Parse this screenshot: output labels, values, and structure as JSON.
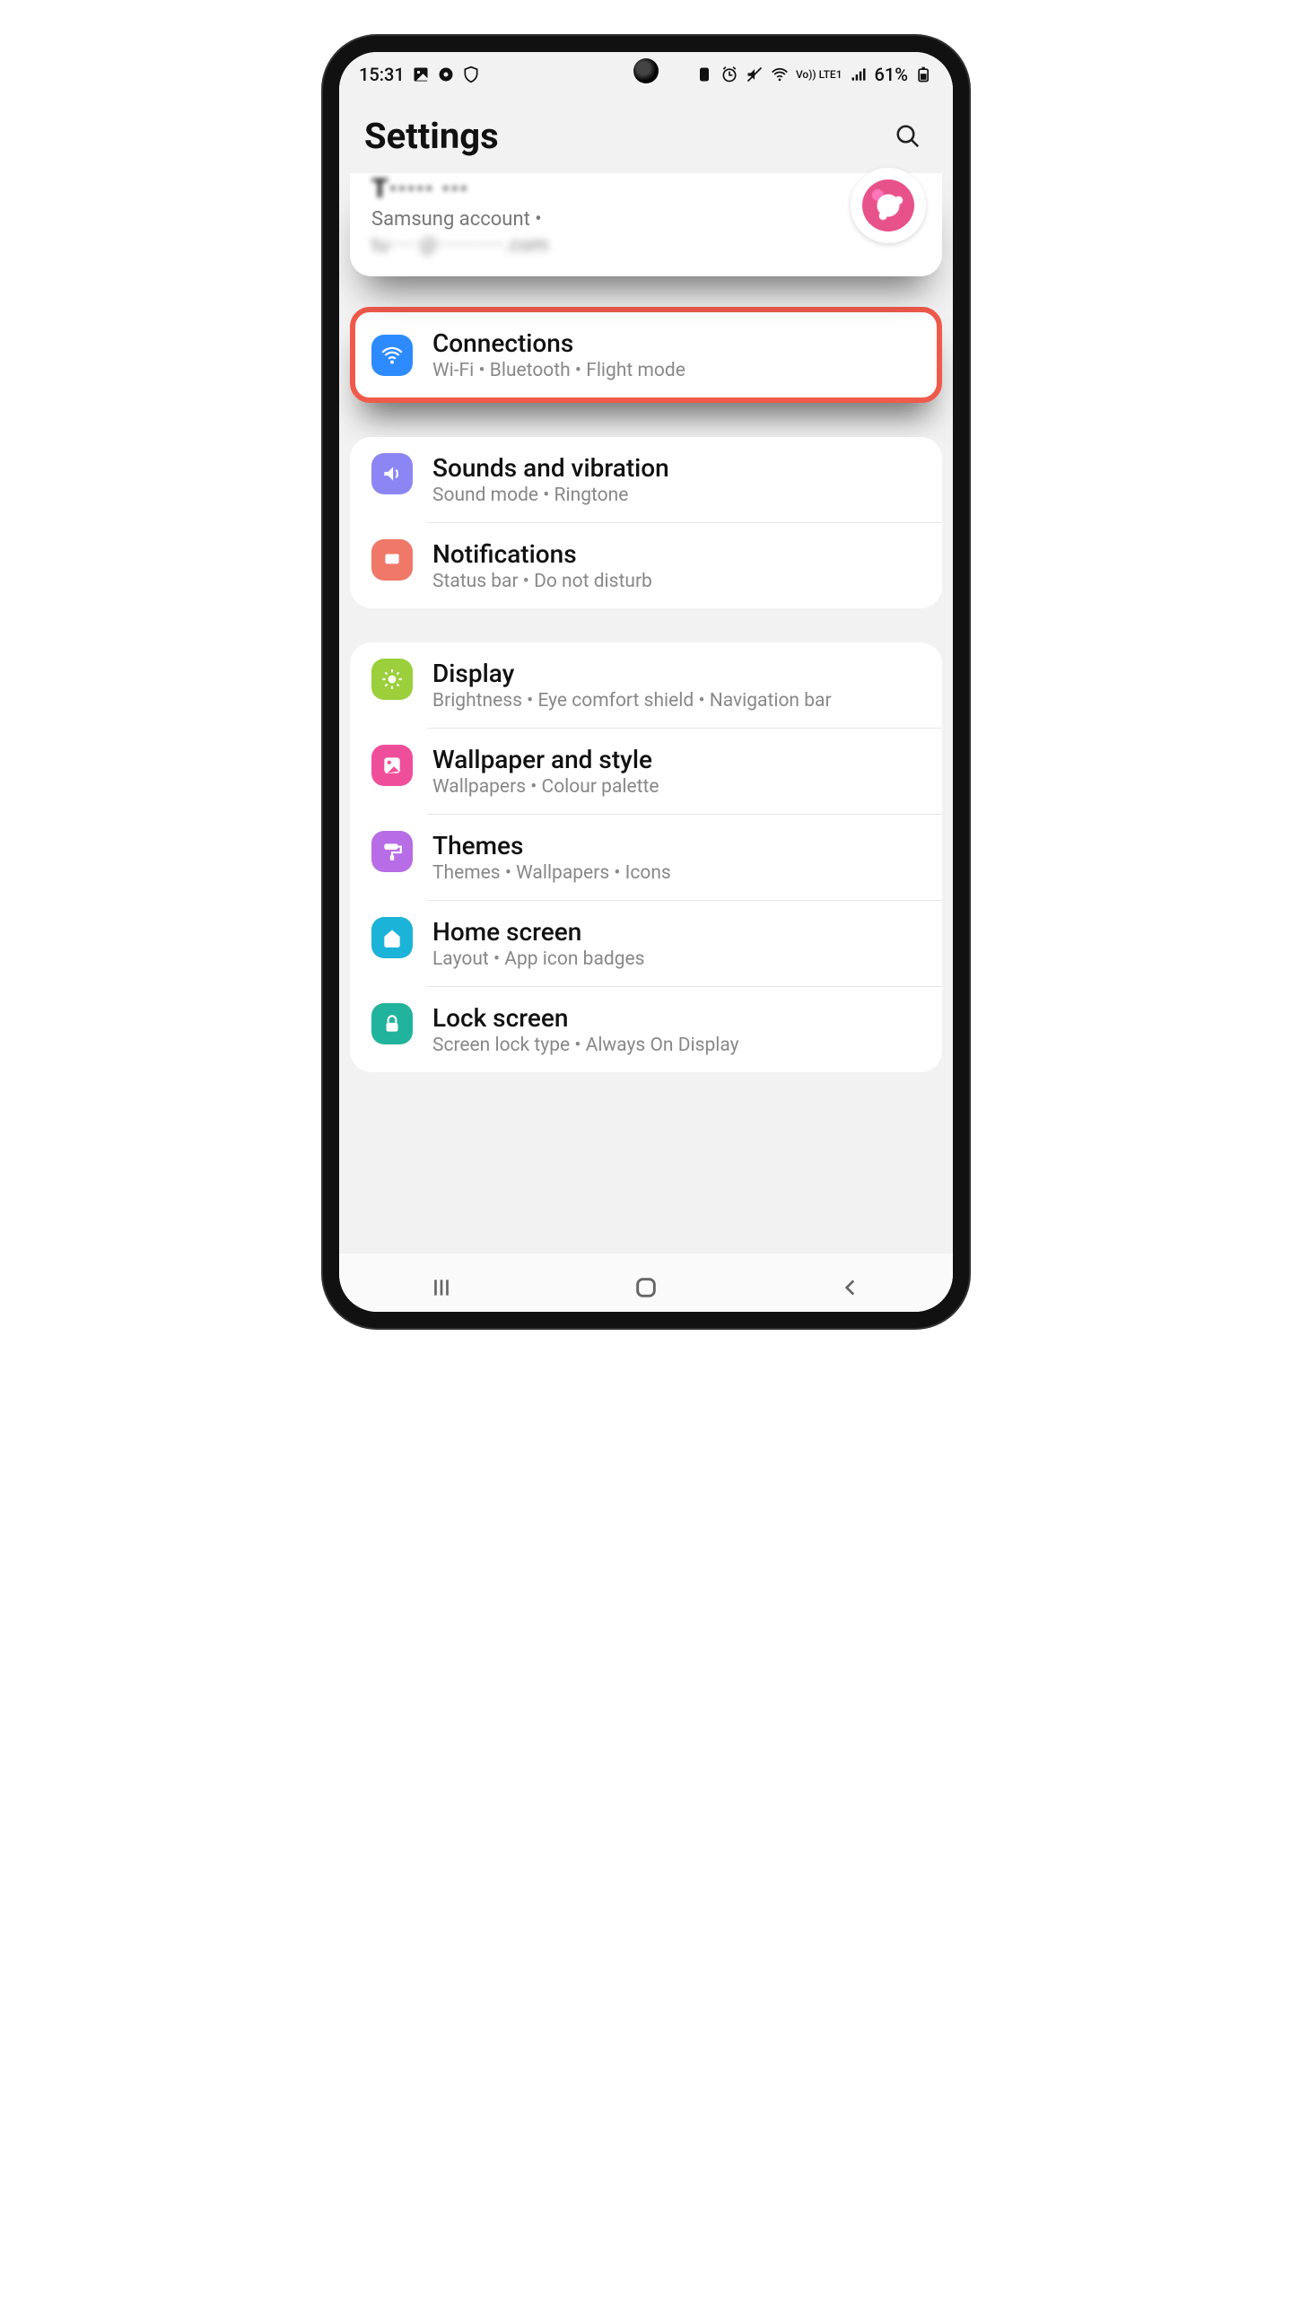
{
  "status": {
    "time": "15:31",
    "battery_text": "61%",
    "volte_text": "Vo))  LTE1"
  },
  "header": {
    "title": "Settings"
  },
  "account": {
    "title_redacted": "T·····  ···",
    "subtitle": "Samsung account  •",
    "email_redacted": "tu······@·············.com"
  },
  "items": {
    "connections": {
      "title": "Connections",
      "subtitle": "Wi-Fi  •  Bluetooth  •  Flight mode",
      "icon_color": "#2d8bff"
    },
    "sounds": {
      "title": "Sounds and vibration",
      "subtitle": "Sound mode  •  Ringtone",
      "icon_color": "#8b86f3"
    },
    "notifications": {
      "title": "Notifications",
      "subtitle": "Status bar  •  Do not disturb",
      "icon_color": "#f07868"
    },
    "display": {
      "title": "Display",
      "subtitle": "Brightness  •  Eye comfort shield  •  Navigation bar",
      "icon_color": "#9bcf3b"
    },
    "wallpaper": {
      "title": "Wallpaper and style",
      "subtitle": "Wallpapers  •  Colour palette",
      "icon_color": "#ef4f9a"
    },
    "themes": {
      "title": "Themes",
      "subtitle": "Themes  •  Wallpapers  •  Icons",
      "icon_color": "#b76de6"
    },
    "home": {
      "title": "Home screen",
      "subtitle": "Layout  •  App icon badges",
      "icon_color": "#1cb3d9"
    },
    "lock": {
      "title": "Lock screen",
      "subtitle": "Screen lock type  •  Always On Display",
      "icon_color": "#21b39b"
    }
  }
}
